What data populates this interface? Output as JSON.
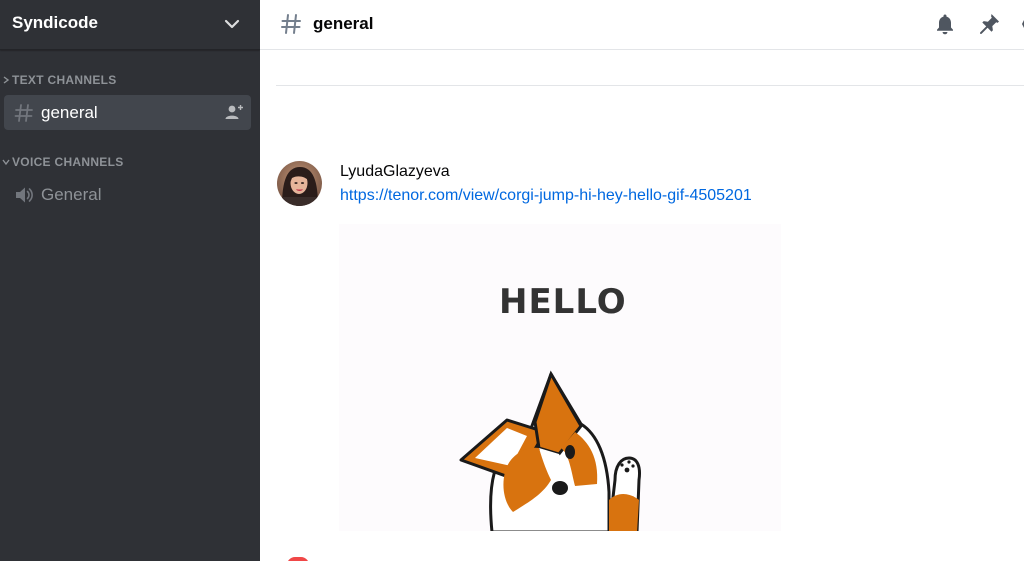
{
  "server": {
    "name": "Syndicode",
    "chevron_icon": "chevron-down-icon"
  },
  "sidebar": {
    "categories": [
      {
        "label": "TEXT CHANNELS",
        "state": "collapsed-arrow",
        "channels": [
          {
            "label": "general",
            "icon": "hash-icon",
            "active": true,
            "action_icon": "invite-icon"
          }
        ]
      },
      {
        "label": "VOICE CHANNELS",
        "state": "expanded-arrow",
        "channels": [
          {
            "label": "General",
            "icon": "speaker-icon",
            "active": false
          }
        ]
      }
    ]
  },
  "header": {
    "channel_name": "general",
    "icons": [
      "hash-icon",
      "bell-icon",
      "pin-icon"
    ]
  },
  "messages": [
    {
      "author": "LyudaGlazyeva",
      "link": "https://tenor.com/view/corgi-jump-hi-hey-hello-gif-4505201",
      "embed": {
        "type": "gif",
        "text": "HELLO"
      }
    }
  ],
  "colors": {
    "sidebar_bg": "#2f3136",
    "active_channel_bg": "#42464d",
    "link": "#0068e0",
    "category_text": "#8e9297",
    "corgi_orange": "#d8730f"
  }
}
